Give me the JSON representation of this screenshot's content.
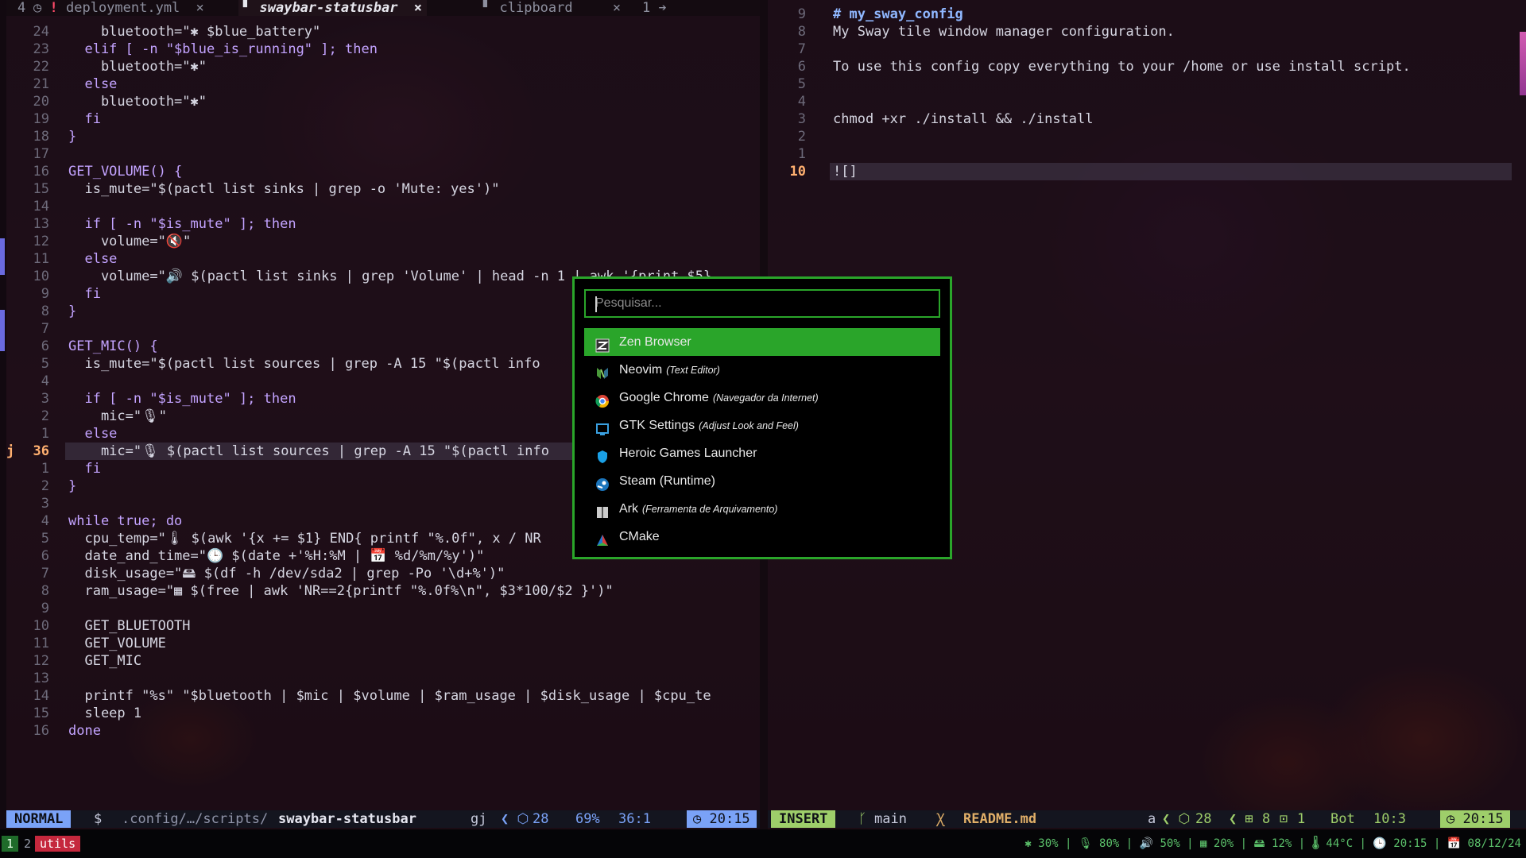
{
  "tabline": {
    "number": "4",
    "tabs": [
      {
        "warn": "!",
        "label": "deployment.yml",
        "close": "×"
      },
      {
        "label": "swaybar-statusbar",
        "close": "×"
      },
      {
        "label": "clipboard",
        "close": "×"
      }
    ],
    "count": "1"
  },
  "left_editor": {
    "lines": [
      {
        "n": "24",
        "t": "    bluetooth=\"✱ $blue_battery\""
      },
      {
        "n": "23",
        "t": "  elif [ -n \"$blue_is_running\" ]; then"
      },
      {
        "n": "22",
        "t": "    bluetooth=\"✱\""
      },
      {
        "n": "21",
        "t": "  else"
      },
      {
        "n": "20",
        "t": "    bluetooth=\"✱\""
      },
      {
        "n": "19",
        "t": "  fi"
      },
      {
        "n": "18",
        "t": "}"
      },
      {
        "n": "17",
        "t": ""
      },
      {
        "n": "16",
        "t": "GET_VOLUME() {"
      },
      {
        "n": "15",
        "t": "  is_mute=\"$(pactl list sinks | grep -o 'Mute: yes')\""
      },
      {
        "n": "14",
        "t": ""
      },
      {
        "n": "13",
        "t": "  if [ -n \"$is_mute\" ]; then"
      },
      {
        "n": "12",
        "t": "    volume=\"🔇\""
      },
      {
        "n": "11",
        "t": "  else"
      },
      {
        "n": "10",
        "t": "    volume=\"🔊 $(pactl list sinks | grep 'Volume' | head -n 1 | awk '{print $5}"
      },
      {
        "n": "9",
        "t": "  fi"
      },
      {
        "n": "8",
        "t": "}"
      },
      {
        "n": "7",
        "t": ""
      },
      {
        "n": "6",
        "t": "GET_MIC() {"
      },
      {
        "n": "5",
        "t": "  is_mute=\"$(pactl list sources | grep -A 15 \"$(pactl info"
      },
      {
        "n": "4",
        "t": ""
      },
      {
        "n": "3",
        "t": "  if [ -n \"$is_mute\" ]; then"
      },
      {
        "n": "2",
        "t": "    mic=\"🎙\""
      },
      {
        "n": "1",
        "t": "  else"
      },
      {
        "n": "36",
        "t": "    mic=\"🎙 $(pactl list sources | grep -A 15 \"$(pactl info",
        "current": true,
        "prefix": "j"
      },
      {
        "n": "1",
        "t": "  fi"
      },
      {
        "n": "2",
        "t": "}"
      },
      {
        "n": "3",
        "t": ""
      },
      {
        "n": "4",
        "t": "while true; do"
      },
      {
        "n": "5",
        "t": "  cpu_temp=\"🌡 $(awk '{x += $1} END{ printf \"%.0f\", x / NR"
      },
      {
        "n": "6",
        "t": "  date_and_time=\"🕒 $(date +'%H:%M | 📅 %d/%m/%y')\""
      },
      {
        "n": "7",
        "t": "  disk_usage=\"🖴 $(df -h /dev/sda2 | grep -Po '\\d+%')\""
      },
      {
        "n": "8",
        "t": "  ram_usage=\"▦ $(free | awk 'NR==2{printf \"%.0f%\\n\", $3*100/$2 }')\""
      },
      {
        "n": "9",
        "t": ""
      },
      {
        "n": "10",
        "t": "  GET_BLUETOOTH"
      },
      {
        "n": "11",
        "t": "  GET_VOLUME"
      },
      {
        "n": "12",
        "t": "  GET_MIC"
      },
      {
        "n": "13",
        "t": ""
      },
      {
        "n": "14",
        "t": "  printf \"%s\" \"$bluetooth | $mic | $volume | $ram_usage | $disk_usage | $cpu_te"
      },
      {
        "n": "15",
        "t": "  sleep 1"
      },
      {
        "n": "16",
        "t": "done"
      }
    ]
  },
  "right_editor": {
    "lines": [
      {
        "n": "9",
        "t": "# my_sway_config",
        "heading": true
      },
      {
        "n": "8",
        "t": "My Sway tile window manager configuration."
      },
      {
        "n": "7",
        "t": ""
      },
      {
        "n": "6",
        "t": "To use this config copy everything to your /home or use install script."
      },
      {
        "n": "5",
        "t": ""
      },
      {
        "n": "4",
        "t": ""
      },
      {
        "n": "3",
        "t": "chmod +xr ./install && ./install"
      },
      {
        "n": "2",
        "t": ""
      },
      {
        "n": "1",
        "t": ""
      },
      {
        "n": "10",
        "t": "![]",
        "current": true
      }
    ]
  },
  "status_left": {
    "mode": "NORMAL",
    "shell": "$",
    "path_prefix": ".config/…/scripts/",
    "file": "swaybar-statusbar",
    "op": "gj",
    "buffers": "28",
    "percent": "69%",
    "pos": "36:1",
    "time": "20:15"
  },
  "status_right": {
    "mode": "INSERT",
    "branch": "main",
    "file": "README.md",
    "reg": "a",
    "buffers": "28",
    "added": "8",
    "changed": "1",
    "where": "Bot",
    "pos": "10:3",
    "time": "20:15"
  },
  "launcher": {
    "placeholder": "Pesquisar...",
    "entries": [
      {
        "name": "Zen Browser",
        "desc": "",
        "icon": "zen-browser-icon",
        "selected": true
      },
      {
        "name": "Neovim",
        "desc": "(Text Editor)",
        "icon": "neovim-icon"
      },
      {
        "name": "Google Chrome",
        "desc": "(Navegador da Internet)",
        "icon": "chrome-icon"
      },
      {
        "name": "GTK Settings",
        "desc": "(Adjust Look and Feel)",
        "icon": "gtk-settings-icon"
      },
      {
        "name": "Heroic Games Launcher",
        "desc": "",
        "icon": "heroic-icon"
      },
      {
        "name": "Steam (Runtime)",
        "desc": "",
        "icon": "steam-icon"
      },
      {
        "name": "Ark",
        "desc": "(Ferramenta de Arquivamento)",
        "icon": "ark-icon"
      },
      {
        "name": "CMake",
        "desc": "",
        "icon": "cmake-icon"
      }
    ]
  },
  "swaybar": {
    "workspaces": [
      "1",
      "2",
      "utils"
    ],
    "status": "✱ 30%  |  🎙 80%  |  🔊 50%  |  ▦ 20%  |  🖴 12%  |  🌡 44°C  |  🕒 20:15  |  📅 08/12/24"
  },
  "colors": {
    "accent_green": "#2aa52a",
    "normal_mode": "#7aa2f7",
    "insert_mode": "#9ece6a",
    "utils_ws": "#c5283d"
  }
}
